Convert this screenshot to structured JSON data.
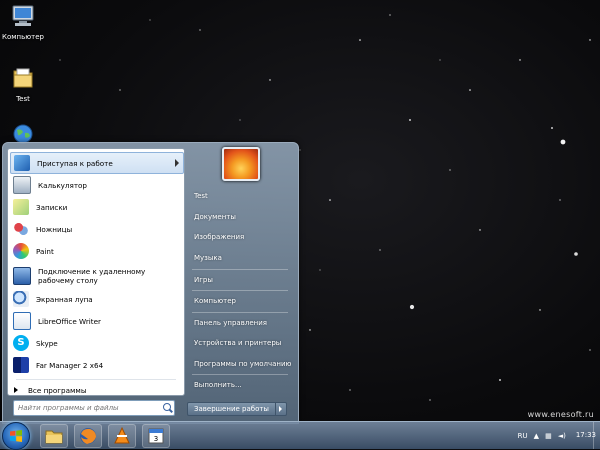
{
  "desktop": {
    "icons": [
      {
        "label": "Компьютер",
        "icon": "computer-icon"
      },
      {
        "label": "Test",
        "icon": "folder-icon"
      },
      {
        "label": "",
        "icon": "network-globe-icon"
      }
    ],
    "watermark": "www.enesoft.ru"
  },
  "start_menu": {
    "programs": [
      {
        "label": "Приступая к работе",
        "icon": "getting-started-icon",
        "has_submenu": true,
        "highlighted": true
      },
      {
        "label": "Калькулятор",
        "icon": "calculator-icon"
      },
      {
        "label": "Записки",
        "icon": "sticky-notes-icon"
      },
      {
        "label": "Ножницы",
        "icon": "snipping-tool-icon"
      },
      {
        "label": "Paint",
        "icon": "paint-icon"
      },
      {
        "label": "Подключение к удаленному рабочему столу",
        "icon": "remote-desktop-icon"
      },
      {
        "label": "Экранная лупа",
        "icon": "magnifier-icon"
      },
      {
        "label": "LibreOffice Writer",
        "icon": "libreoffice-writer-icon"
      },
      {
        "label": "Skype",
        "icon": "skype-icon"
      },
      {
        "label": "Far Manager 2 x64",
        "icon": "far-manager-icon"
      }
    ],
    "all_programs_label": "Все программы",
    "search_placeholder": "Найти программы и файлы",
    "right_links": [
      {
        "label": "Test"
      },
      {
        "label": "Документы"
      },
      {
        "label": "Изображения"
      },
      {
        "label": "Музыка"
      },
      {
        "label": "Игры"
      },
      {
        "label": "Компьютер"
      },
      {
        "label": "Панель управления"
      },
      {
        "label": "Устройства и принтеры"
      },
      {
        "label": "Программы по умолчанию"
      },
      {
        "label": "Выполнить..."
      }
    ],
    "shutdown_label": "Завершение работы"
  },
  "taskbar": {
    "pinned": [
      "explorer-icon",
      "firefox-icon",
      "vlc-icon",
      "calendar-app-icon"
    ],
    "language": "RU",
    "clock_time": "17:33",
    "clock_date": "",
    "colors": {
      "accent": "#2a6cbd"
    }
  }
}
